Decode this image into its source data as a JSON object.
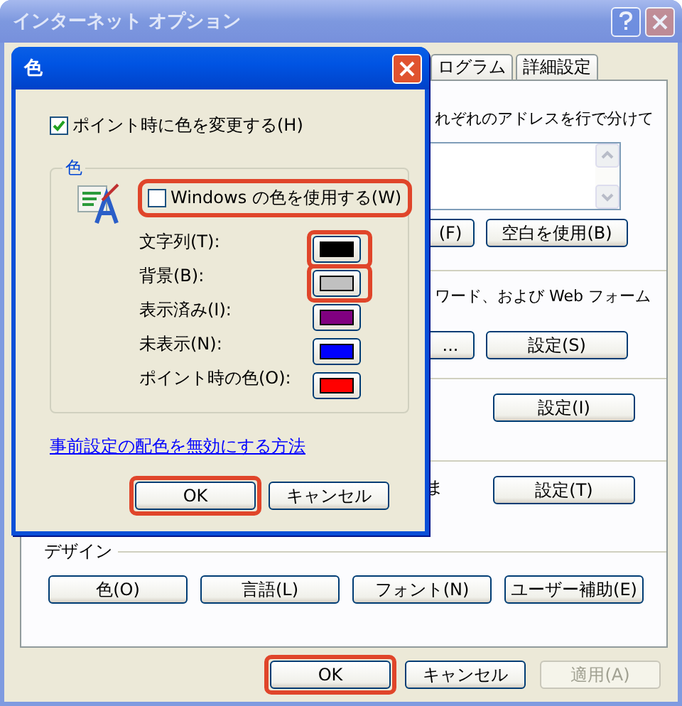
{
  "window": {
    "title": "インターネット オプション",
    "active": false
  },
  "tabs": [
    {
      "label": "ログラム",
      "selected": false
    },
    {
      "label": "詳細設定",
      "selected": false
    }
  ],
  "panel": {
    "address_text": "れぞれのアドレスを行で分けて",
    "address_buttons": [
      "(F)",
      "空白を使用(B)"
    ],
    "autocomplete_text": "ワード、および Web フォーム",
    "autocomplete_buttons": [
      "...",
      "設定(S)"
    ],
    "feed_button": "設定(I)",
    "row_text": "ま",
    "row_button": "設定(T)",
    "design_group": {
      "label": "デザイン",
      "buttons": [
        "色(O)",
        "言語(L)",
        "フォント(N)",
        "ユーザー補助(E)"
      ]
    }
  },
  "footer_buttons": [
    {
      "label": "OK",
      "highlighted": true,
      "disabled": false
    },
    {
      "label": "キャンセル",
      "highlighted": false,
      "disabled": false
    },
    {
      "label": "適用(A)",
      "highlighted": false,
      "disabled": true
    }
  ],
  "color_dialog": {
    "title": "色",
    "active": true,
    "hover_checkbox": {
      "label": "ポイント時に色を変更する(H)",
      "checked": true
    },
    "group_label": "色",
    "windows_checkbox": {
      "label": "Windows の色を使用する(W)",
      "checked": false,
      "highlighted": true
    },
    "colors": [
      {
        "label": "文字列(T):",
        "color": "#000000",
        "highlighted": true
      },
      {
        "label": "背景(B):",
        "color": "#c0c0c0",
        "highlighted": true
      },
      {
        "label": "表示済み(I):",
        "color": "#800080",
        "highlighted": false
      },
      {
        "label": "未表示(N):",
        "color": "#0000ff",
        "highlighted": false
      },
      {
        "label": "ポイント時の色(O):",
        "color": "#ff0000",
        "highlighted": false
      }
    ],
    "link": "事前設定の配色を無効にする方法",
    "buttons": [
      {
        "label": "OK",
        "highlighted": true
      },
      {
        "label": "キャンセル",
        "highlighted": false
      }
    ]
  }
}
